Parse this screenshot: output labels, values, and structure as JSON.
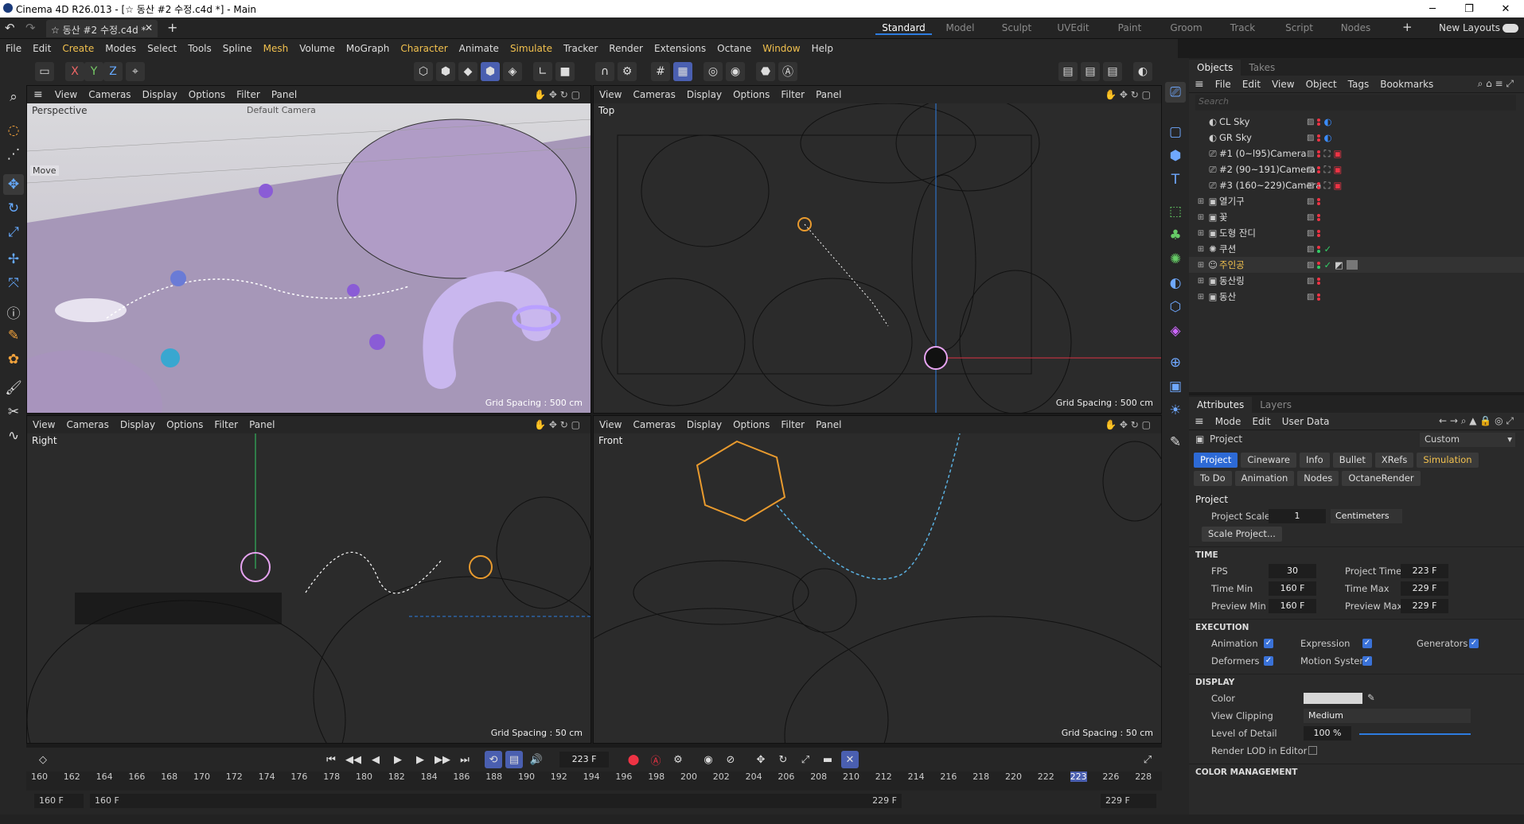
{
  "window": {
    "title": "Cinema 4D R26.013 - [☆ 동산 #2 수정.c4d *] - Main",
    "doc_tab": "☆ 동산 #2 수정.c4d *"
  },
  "layouts": [
    "Standard",
    "Model",
    "Sculpt",
    "UVEdit",
    "Paint",
    "Groom",
    "Track",
    "Script",
    "Nodes"
  ],
  "layouts_extra": {
    "plus": "+",
    "new_layouts": "New Layouts"
  },
  "menu": [
    "File",
    "Edit",
    "Create",
    "Modes",
    "Select",
    "Tools",
    "Spline",
    "Mesh",
    "Volume",
    "MoGraph",
    "Character",
    "Animate",
    "Simulate",
    "Tracker",
    "Render",
    "Extensions",
    "Octane",
    "Window",
    "Help"
  ],
  "axis_buttons": [
    "X",
    "Y",
    "Z"
  ],
  "viewport_menu": [
    "View",
    "Cameras",
    "Display",
    "Options",
    "Filter",
    "Panel"
  ],
  "viewports": [
    {
      "label": "Perspective",
      "camera": "Default Camera",
      "grid": "Grid Spacing : 500 cm",
      "hud": "Move"
    },
    {
      "label": "Top",
      "grid": "Grid Spacing : 500 cm"
    },
    {
      "label": "Right",
      "grid": "Grid Spacing : 50 cm"
    },
    {
      "label": "Front",
      "grid": "Grid Spacing : 50 cm"
    }
  ],
  "objects_tabs": [
    "Objects",
    "Takes"
  ],
  "objects_menu": [
    "File",
    "Edit",
    "View",
    "Object",
    "Tags",
    "Bookmarks"
  ],
  "search_placeholder": "Search",
  "objects": [
    {
      "name": "CL Sky",
      "icon": "sky-icon",
      "tag": "sky"
    },
    {
      "name": "GR Sky",
      "icon": "sky-icon",
      "tag": "sky"
    },
    {
      "name": "#1 (0~l95)Camera",
      "icon": "camera-icon",
      "tag": "camera"
    },
    {
      "name": "#2 (90~191)Camera",
      "icon": "camera-icon",
      "tag": "camera"
    },
    {
      "name": "#3 (160~229)Camera",
      "icon": "camera-icon",
      "tag": "camera"
    },
    {
      "name": "열기구",
      "icon": "null-icon",
      "tag": ""
    },
    {
      "name": "꽃",
      "icon": "null-icon",
      "tag": ""
    },
    {
      "name": "도형 잔디",
      "icon": "null-icon",
      "tag": ""
    },
    {
      "name": "쿠션",
      "icon": "cloner-icon",
      "tag": "check"
    },
    {
      "name": "주인공",
      "icon": "character-icon",
      "tag": "check-material"
    },
    {
      "name": "동산링",
      "icon": "null-icon",
      "tag": ""
    },
    {
      "name": "동산",
      "icon": "null-icon",
      "tag": ""
    }
  ],
  "attributes_tabs": [
    "Attributes",
    "Layers"
  ],
  "attributes_menu": [
    "Mode",
    "Edit",
    "User Data"
  ],
  "attr_mode": "Custom",
  "attr_object": "Project",
  "attr_tabs": [
    "Project",
    "Cineware",
    "Info",
    "Bullet",
    "XRefs",
    "Simulation",
    "To Do",
    "Animation",
    "Nodes",
    "OctaneRender"
  ],
  "project": {
    "heading": "Project",
    "scale_label": "Project Scale",
    "scale_value": "1",
    "scale_unit": "Centimeters",
    "scale_btn": "Scale Project...",
    "time_section": "TIME",
    "fps_label": "FPS",
    "fps": "30",
    "ptime_label": "Project Time",
    "ptime": "223 F",
    "tmin_label": "Time Min",
    "tmin": "160 F",
    "tmax_label": "Time Max",
    "tmax": "229 F",
    "pmin_label": "Preview Min",
    "pmin": "160 F",
    "pmax_label": "Preview Max",
    "pmax": "229 F",
    "exec_section": "EXECUTION",
    "anim_label": "Animation",
    "expr_label": "Expression",
    "gen_label": "Generators",
    "def_label": "Deformers",
    "motion_label": "Motion System",
    "display_section": "DISPLAY",
    "color_label": "Color",
    "clip_label": "View Clipping",
    "clip_value": "Medium",
    "lod_label": "Level of Detail",
    "lod_value": "100 %",
    "lod_fraction": 1.0,
    "render_lod_label": "Render LOD in Editor",
    "color_section": "COLOR MANAGEMENT"
  },
  "timeline": {
    "current_frame": "223 F",
    "ticks": [
      "160",
      "162",
      "164",
      "166",
      "168",
      "170",
      "172",
      "174",
      "176",
      "178",
      "180",
      "182",
      "184",
      "186",
      "188",
      "190",
      "192",
      "194",
      "196",
      "198",
      "200",
      "202",
      "204",
      "206",
      "208",
      "210",
      "212",
      "214",
      "216",
      "218",
      "220",
      "222",
      "223",
      "226",
      "228"
    ],
    "start": "160 F",
    "preview_start": "160 F",
    "preview_end": "229 F",
    "end": "229 F"
  }
}
